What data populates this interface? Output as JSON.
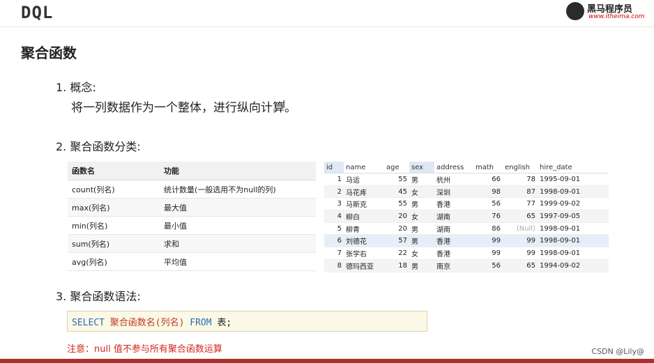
{
  "header": {
    "title": "DQL",
    "logo_name": "黑马程序员",
    "logo_url": "www.itheima.com"
  },
  "section_title": "聚合函数",
  "concept": {
    "label": "1.  概念:",
    "text": "将一列数据作为一个整体，进行纵向计算。"
  },
  "categories": {
    "label": "2. 聚合函数分类:",
    "headers": [
      "函数名",
      "功能"
    ],
    "rows": [
      [
        "count(列名)",
        "统计数量(一般选用不为null的列)"
      ],
      [
        "max(列名)",
        "最大值"
      ],
      [
        "min(列名)",
        "最小值"
      ],
      [
        "sum(列名)",
        "求和"
      ],
      [
        "avg(列名)",
        "平均值"
      ]
    ]
  },
  "data_table": {
    "headers": [
      "id",
      "name",
      "age",
      "sex",
      "address",
      "math",
      "english",
      "hire_date"
    ],
    "rows": [
      [
        "1",
        "马运",
        "55",
        "男",
        "杭州",
        "66",
        "78",
        "1995-09-01"
      ],
      [
        "2",
        "马花疼",
        "45",
        "女",
        "深圳",
        "98",
        "87",
        "1998-09-01"
      ],
      [
        "3",
        "马斯克",
        "55",
        "男",
        "香港",
        "56",
        "77",
        "1999-09-02"
      ],
      [
        "4",
        "柳白",
        "20",
        "女",
        "湖南",
        "76",
        "65",
        "1997-09-05"
      ],
      [
        "5",
        "柳青",
        "20",
        "男",
        "湖南",
        "86",
        "(Null)",
        "1998-09-01"
      ],
      [
        "6",
        "刘德花",
        "57",
        "男",
        "香港",
        "99",
        "99",
        "1998-09-01"
      ],
      [
        "7",
        "张学右",
        "22",
        "女",
        "香港",
        "99",
        "99",
        "1998-09-01"
      ],
      [
        "8",
        "德玛西亚",
        "18",
        "男",
        "南京",
        "56",
        "65",
        "1994-09-02"
      ]
    ]
  },
  "syntax": {
    "label": "3. 聚合函数语法:",
    "kw_select": "SELECT",
    "func_part": "聚合函数名(列名)",
    "kw_from": "FROM",
    "table_part": "表;"
  },
  "note": "注意：null 值不参与所有聚合函数运算",
  "watermark": "CSDN @Lily@",
  "colors": {
    "keyword": "#2e6bb5",
    "function": "#c0392b",
    "note": "#d1261c",
    "bottom_bar": "#a8322c"
  }
}
